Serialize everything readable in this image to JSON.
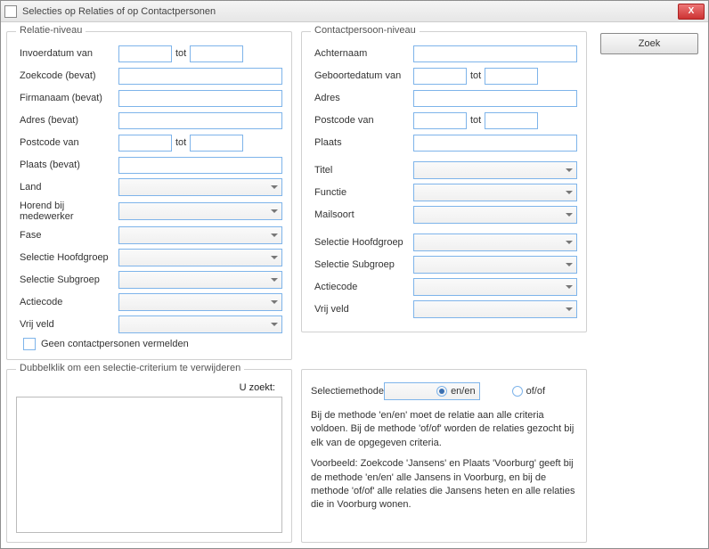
{
  "window": {
    "title": "Selecties op Relaties of op Contactpersonen",
    "close_x": "X"
  },
  "zoek": {
    "label": "Zoek"
  },
  "relatie": {
    "legend": "Relatie-niveau",
    "invoerdatum": "Invoerdatum van",
    "tot": "tot",
    "zoekcode": "Zoekcode (bevat)",
    "firmanaam": "Firmanaam (bevat)",
    "adres": "Adres (bevat)",
    "postcode": "Postcode van",
    "plaats": "Plaats (bevat)",
    "land": "Land",
    "medewerker": "Horend bij medewerker",
    "fase": "Fase",
    "hoofdgroep": "Selectie Hoofdgroep",
    "subgroep": "Selectie Subgroep",
    "actiecode": "Actiecode",
    "vrijveld": "Vrij veld",
    "geen_contact": "Geen contactpersonen vermelden"
  },
  "contact": {
    "legend": "Contactpersoon-niveau",
    "achternaam": "Achternaam",
    "geboortedatum": "Geboortedatum van",
    "tot": "tot",
    "adres": "Adres",
    "postcode": "Postcode van",
    "plaats": "Plaats",
    "titel": "Titel",
    "functie": "Functie",
    "mailsoort": "Mailsoort",
    "hoofdgroep": "Selectie Hoofdgroep",
    "subgroep": "Selectie Subgroep",
    "actiecode": "Actiecode",
    "vrijveld": "Vrij veld"
  },
  "remove": {
    "legend": "Dubbelklik om een selectie-criterium te verwijderen",
    "uzoekt": "U zoekt:"
  },
  "method": {
    "label": "Selectiemethode",
    "enen": "en/en",
    "ofof": "of/of",
    "desc1": "Bij de methode 'en/en' moet de relatie aan alle criteria voldoen. Bij de methode 'of/of' worden de relaties gezocht bij elk van de opgegeven criteria.",
    "desc2": "Voorbeeld: Zoekcode 'Jansens' en Plaats 'Voorburg' geeft bij de methode 'en/en' alle Jansens in Voorburg, en bij de methode 'of/of' alle relaties die Jansens heten en alle relaties die in Voorburg wonen."
  }
}
